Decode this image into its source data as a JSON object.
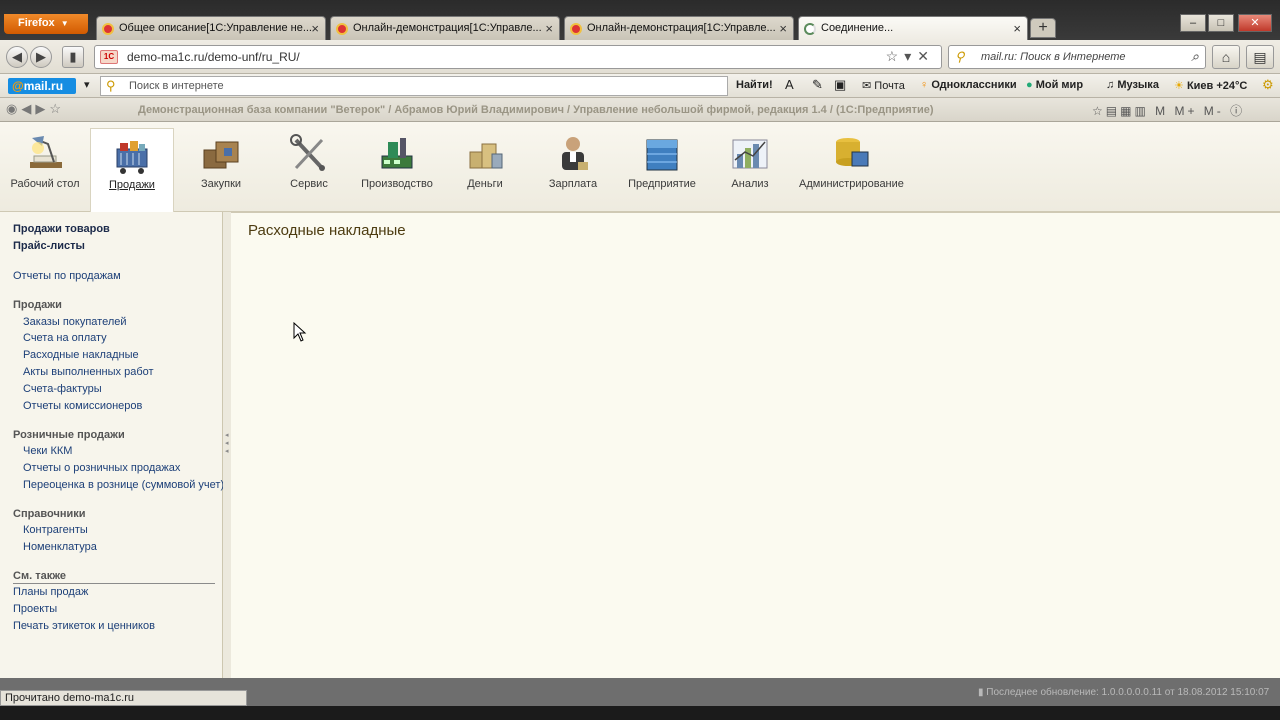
{
  "browser": {
    "menu_label": "Firefox",
    "tabs": [
      {
        "label": "Общее описание[1С:Управление не..."
      },
      {
        "label": "Онлайн-демонстрация[1С:Управле..."
      },
      {
        "label": "Онлайн-демонстрация[1С:Управле..."
      },
      {
        "label": "Соединение..."
      }
    ],
    "new_tab": "+",
    "url": "demo-ma1c.ru/demo-unf/ru_RU/",
    "search_placeholder": "mail.ru: Поиск в Интернете"
  },
  "mailru_bar": {
    "logo_at": "@",
    "logo_text": "mail.ru",
    "search_placeholder": "Поиск в интернете",
    "find_label": "Найти!",
    "mail_label": "Почта",
    "ok_label": "Одноклассники",
    "myworld_label": "Мой мир",
    "music_label": "Музыка",
    "weather_label": "Киев +24°C"
  },
  "bookmark_bar": {
    "title": "Демонстрационная база компании \"Ветерок\" / Абрамов Юрий Владимирович / Управление небольшой фирмой, редакция 1.4 / (1С:Предприятие)",
    "right_tools": "M M+ M-"
  },
  "sections": [
    {
      "label": "Рабочий стол",
      "icon": "desk-lamp-icon"
    },
    {
      "label": "Продажи",
      "icon": "sales-cart-icon"
    },
    {
      "label": "Закупки",
      "icon": "purchase-boxes-icon"
    },
    {
      "label": "Сервис",
      "icon": "service-tools-icon"
    },
    {
      "label": "Производство",
      "icon": "factory-icon"
    },
    {
      "label": "Деньги",
      "icon": "money-coins-icon"
    },
    {
      "label": "Зарплата",
      "icon": "salary-worker-icon"
    },
    {
      "label": "Предприятие",
      "icon": "enterprise-building-icon"
    },
    {
      "label": "Анализ",
      "icon": "analysis-chart-icon"
    },
    {
      "label": "Администрирование",
      "icon": "admin-database-icon"
    }
  ],
  "left_nav": {
    "top_bold": [
      "Продажи товаров",
      "Прайс-листы"
    ],
    "reports_link": "Отчеты по продажам",
    "group_sales": "Продажи",
    "sales_items": [
      "Заказы покупателей",
      "Счета на оплату",
      "Расходные накладные",
      "Акты выполненных работ",
      "Счета-фактуры",
      "Отчеты комиссионеров"
    ],
    "group_retail": "Розничные продажи",
    "retail_items": [
      "Чеки ККМ",
      "Отчеты о розничных продажах",
      "Переоценка в рознице (суммовой учет)"
    ],
    "group_refs": "Справочники",
    "refs_items": [
      "Контрагенты",
      "Номенклатура"
    ],
    "see_also": "См. также",
    "see_also_items": [
      "Планы продаж",
      "Проекты",
      "Печать этикеток и ценников"
    ]
  },
  "main": {
    "title": "Расходные накладные"
  },
  "status": {
    "left": "Прочитано demo-ma1c.ru",
    "right": "Последнее обновление: 1.0.0.0.0.0.11 от 18.08.2012 15:10:07"
  }
}
